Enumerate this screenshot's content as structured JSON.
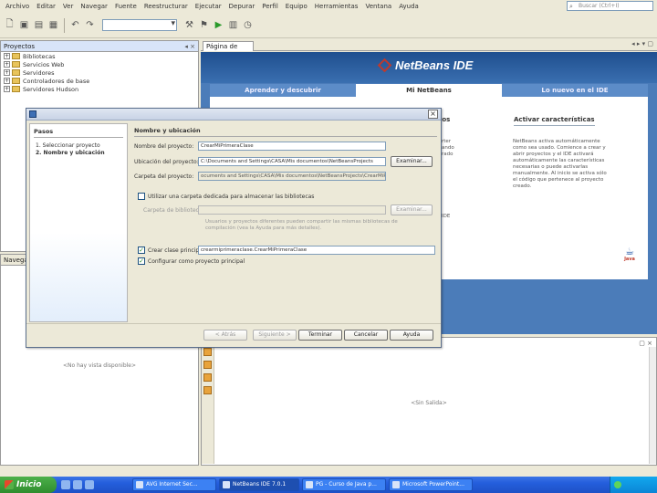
{
  "menu": [
    "Archivo",
    "Editar",
    "Ver",
    "Navegar",
    "Fuente",
    "Reestructurar",
    "Ejecutar",
    "Depurar",
    "Perfil",
    "Equipo",
    "Herramientas",
    "Ventana",
    "Ayuda"
  ],
  "search_placeholder": "Buscar (Ctrl+I)",
  "projects_panel": {
    "title": "Proyectos",
    "items": [
      "Bibliotecas",
      "Servicios Web",
      "Servidores",
      "Controladores de base",
      "Servidores Hudson"
    ]
  },
  "navigator_panel": {
    "title": "Navegador",
    "empty_text": "<No hay vista disponible>"
  },
  "editor_tab": "Página de Inicio",
  "start_page": {
    "logo": "NetBeans IDE",
    "tabs": [
      "Aprender y descubrir",
      "Mi NetBeans",
      "Lo nuevo en el IDE"
    ],
    "col_partial_title": "ntos",
    "activate_title": "Activar características",
    "partial_lines": [
      "rter",
      "ando",
      "rado",
      "IDE"
    ],
    "activate_text": [
      "NetBeans activa automáticamente",
      "como sea usado. Comience a crear y",
      "abrir proyectos y el IDE activará",
      "automáticamente las características",
      "necesarias o puede activarlas",
      "manualmente. Al inicio se activa sólo",
      "el código que pertenece al proyecto",
      "creado."
    ],
    "java_label": "Java"
  },
  "output": {
    "empty_text": "<Sin Salida>"
  },
  "dialog": {
    "steps_title": "Pasos",
    "steps": [
      "1.   Seleccionar proyecto",
      "2.   Nombre y ubicación"
    ],
    "section_title": "Nombre y ubicación",
    "project_name_label": "Nombre del proyecto:",
    "project_name_value": "CrearMiPrimeraClase",
    "project_location_label": "Ubicación del proyecto:",
    "project_location_value": "C:\\Documents and Settings\\CASA\\Mis documentos\\NetBeansProjects",
    "browse_label": "Examinar...",
    "project_folder_label": "Carpeta del proyecto:",
    "project_folder_value": "ocuments and Settings\\CASA\\Mis documentos\\NetBeansProjects\\CrearMiPrimeraClase",
    "dedicated_folder_label": "Utilizar una carpeta dedicada para almacenar las bibliotecas",
    "libraries_folder_label": "Carpeta de bibliotecas:",
    "browse2_label": "Examinar...",
    "libraries_note": [
      "Usuarios y proyectos diferentes pueden compartir las mismas bibliotecas de",
      "compilación (vea la Ayuda para más detalles)."
    ],
    "main_class_label": "Crear clase principal",
    "main_class_value": "crearmiprimeraclase.CrearMiPrimeraClase",
    "set_main_label": "Configurar como proyecto principal",
    "buttons": [
      "< Atrás",
      "Siguiente >",
      "Terminar",
      "Cancelar",
      "Ayuda"
    ]
  },
  "taskbar": {
    "start": "Inicio",
    "tasks": [
      "AVG Internet Sec...",
      "NetBeans IDE 7.0.1",
      "PG - Curso de Java p...",
      "Microsoft PowerPoint..."
    ],
    "clock": ""
  }
}
